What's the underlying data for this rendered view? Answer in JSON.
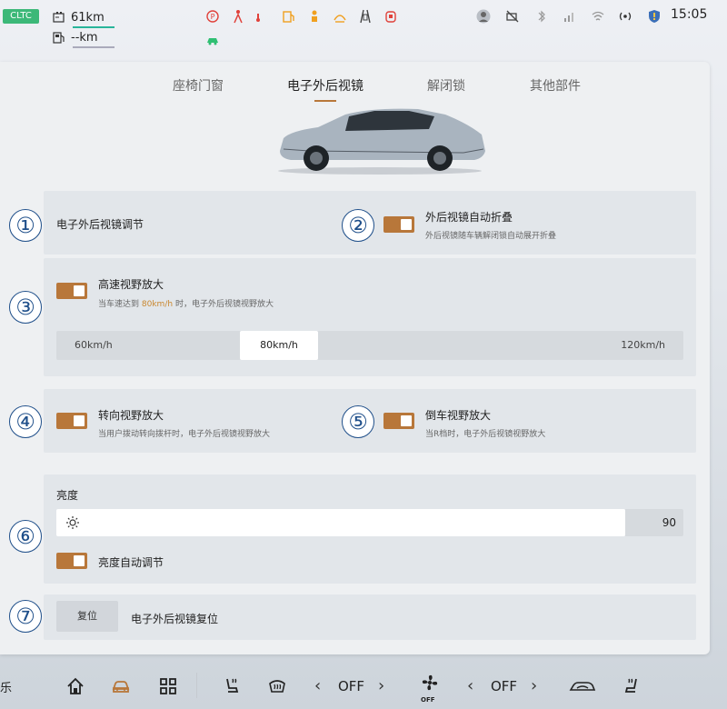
{
  "status": {
    "cycle_label": "CLTC",
    "range_electric": "61km",
    "range_fuel": "--km",
    "time": "15:05"
  },
  "tabs": [
    {
      "label": "座椅门窗",
      "active": false
    },
    {
      "label": "电子外后视镜",
      "active": true
    },
    {
      "label": "解闭锁",
      "active": false
    },
    {
      "label": "其他部件",
      "active": false
    }
  ],
  "sections": {
    "mirror_adjust": {
      "title": "电子外后视镜调节"
    },
    "auto_fold": {
      "title": "外后视镜自动折叠",
      "subtitle": "外后视镜随车辆解闭锁自动展开折叠",
      "enabled": true
    },
    "high_speed": {
      "title": "高速视野放大",
      "subtitle_prefix": "当车速达到",
      "subtitle_highlight": "80km/h",
      "subtitle_suffix": "时，电子外后视镜视野放大",
      "enabled": true,
      "speed_options": [
        "60km/h",
        "80km/h",
        "120km/h"
      ],
      "selected_speed": "80km/h"
    },
    "turn_view": {
      "title": "转向视野放大",
      "subtitle": "当用户拨动转向拨杆时，电子外后视镜视野放大",
      "enabled": true
    },
    "reverse_view": {
      "title": "倒车视野放大",
      "subtitle": "当R档时，电子外后视镜视野放大",
      "enabled": true
    },
    "brightness": {
      "title": "亮度",
      "value": "90",
      "auto_label": "亮度自动调节",
      "auto_enabled": true
    },
    "reset": {
      "button_label": "复位",
      "title": "电子外后视镜复位"
    }
  },
  "annotations": [
    "①",
    "②",
    "③",
    "④",
    "⑤",
    "⑥",
    "⑦"
  ],
  "dock": {
    "left_edge_text": "乐",
    "fan_left": "OFF",
    "fan_center": "OFF",
    "fan_right": "OFF"
  },
  "colors": {
    "accent": "#b8773a",
    "cltc_badge": "#3cb878",
    "annotation": "#1f4f8a",
    "highlight": "#c9872f"
  }
}
